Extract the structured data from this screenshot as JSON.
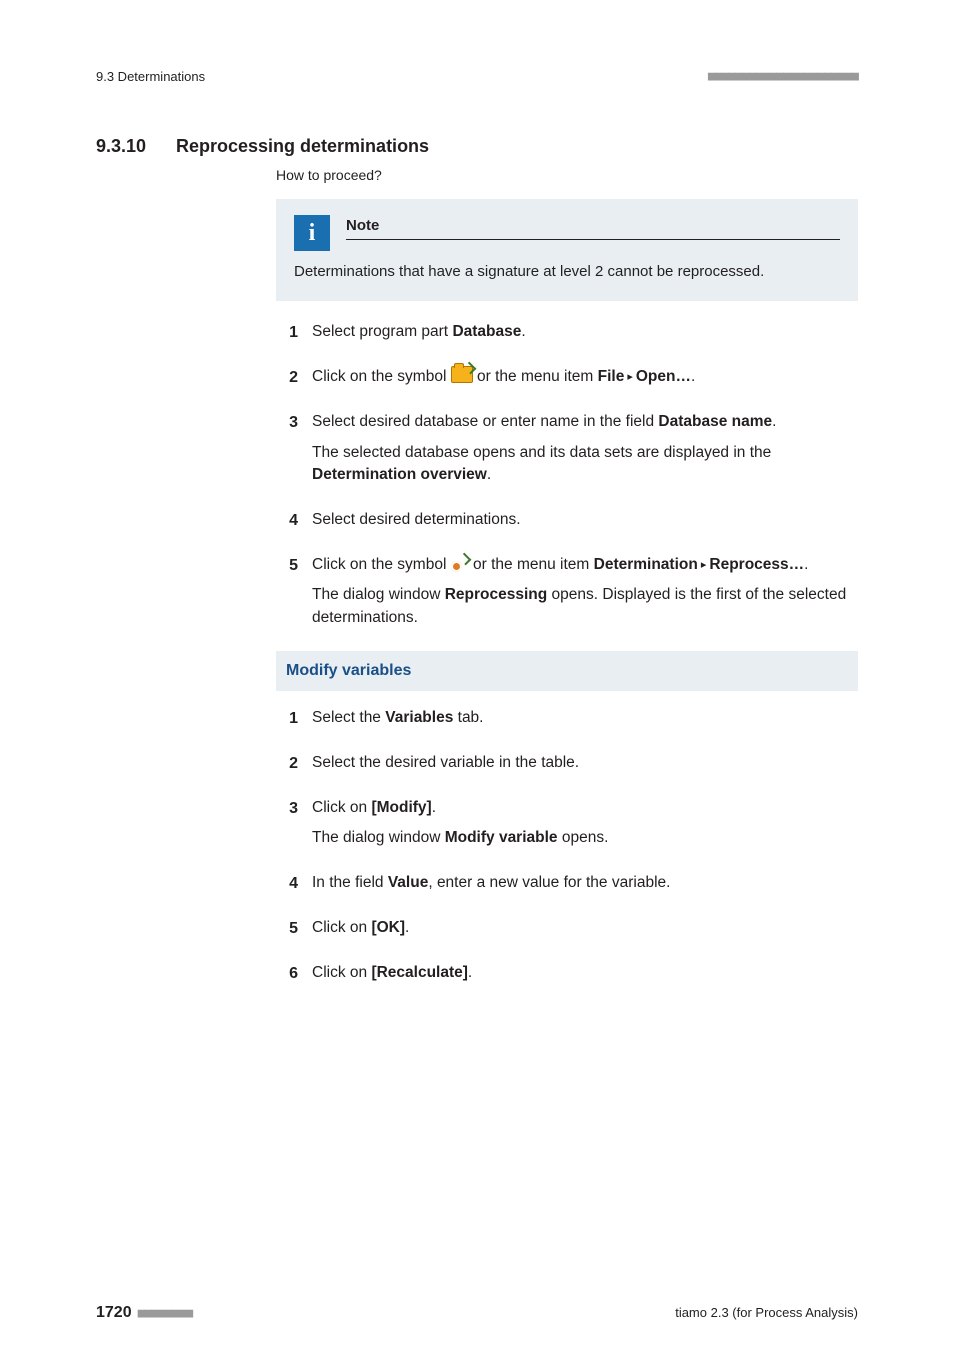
{
  "header": {
    "left": "9.3 Determinations",
    "right_dashes": "■■■■■■■■■■■■■■■■■■■■■■"
  },
  "section": {
    "number": "9.3.10",
    "title": "Reprocessing determinations",
    "proceed": "How to proceed?"
  },
  "note": {
    "label": "Note",
    "body": "Determinations that have a signature at level 2 cannot be reprocessed."
  },
  "steps_a": {
    "s1_a": "Select program part ",
    "s1_b": "Database",
    "s1_c": ".",
    "s2_a": "Click on the symbol ",
    "s2_b": " or the menu item ",
    "s2_c": "File",
    "s2_d": "Open…",
    "s2_e": ".",
    "s3_a": "Select desired database or enter name in the field ",
    "s3_b": "Database name",
    "s3_c": ".",
    "s3_sub_a": "The selected database opens and its data sets are displayed in the ",
    "s3_sub_b": "Determination overview",
    "s3_sub_c": ".",
    "s4": "Select desired determinations.",
    "s5_a": "Click on the symbol ",
    "s5_b": " or the menu item ",
    "s5_c": "Determination",
    "s5_d": "Reprocess…",
    "s5_e": ".",
    "s5_sub_a": "The dialog window ",
    "s5_sub_b": "Reprocessing",
    "s5_sub_c": " opens. Displayed is the first of the selected determinations."
  },
  "subhead": "Modify variables",
  "steps_b": {
    "s1_a": "Select the ",
    "s1_b": "Variables",
    "s1_c": " tab.",
    "s2": "Select the desired variable in the table.",
    "s3_a": "Click on ",
    "s3_b": "[Modify]",
    "s3_c": ".",
    "s3_sub_a": "The dialog window ",
    "s3_sub_b": "Modify variable",
    "s3_sub_c": " opens.",
    "s4_a": "In the field ",
    "s4_b": "Value",
    "s4_c": ", enter a new value for the variable.",
    "s5_a": "Click on ",
    "s5_b": "[OK]",
    "s5_c": ".",
    "s6_a": "Click on ",
    "s6_b": "[Recalculate]",
    "s6_c": "."
  },
  "nums": {
    "n1": "1",
    "n2": "2",
    "n3": "3",
    "n4": "4",
    "n5": "5",
    "n6": "6"
  },
  "triangle": "▸",
  "footer": {
    "page": "1720",
    "left_dashes": "■■■■■■■■",
    "right": "tiamo 2.3 (for Process Analysis)"
  }
}
